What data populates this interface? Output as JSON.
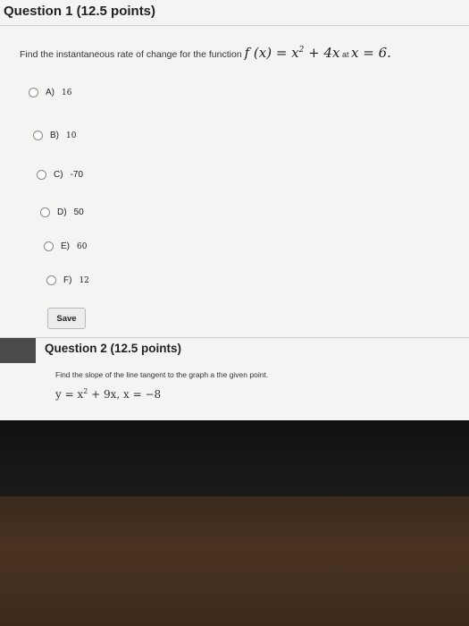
{
  "question1": {
    "title": "Question 1 (12.5 points)",
    "prompt_text": "Find the instantaneous rate of change for the function",
    "function_expr": "f (x) = x",
    "function_exp": "2",
    "function_rest": " + 4x",
    "at_label": " at ",
    "point_expr": "x = 6.",
    "options": [
      {
        "letter": "A)",
        "value": "16"
      },
      {
        "letter": "B)",
        "value": "10"
      },
      {
        "letter": "C)",
        "value": "-70"
      },
      {
        "letter": "D)",
        "value": "50"
      },
      {
        "letter": "E)",
        "value": "60"
      },
      {
        "letter": "F)",
        "value": "12"
      }
    ],
    "save_label": "Save"
  },
  "question2": {
    "title": "Question 2 (12.5 points)",
    "prompt_text": "Find the slope of the line tangent to the graph a the given point.",
    "eq_start": "y = x",
    "eq_exp": "2",
    "eq_rest": " + 9x, x = −8"
  }
}
